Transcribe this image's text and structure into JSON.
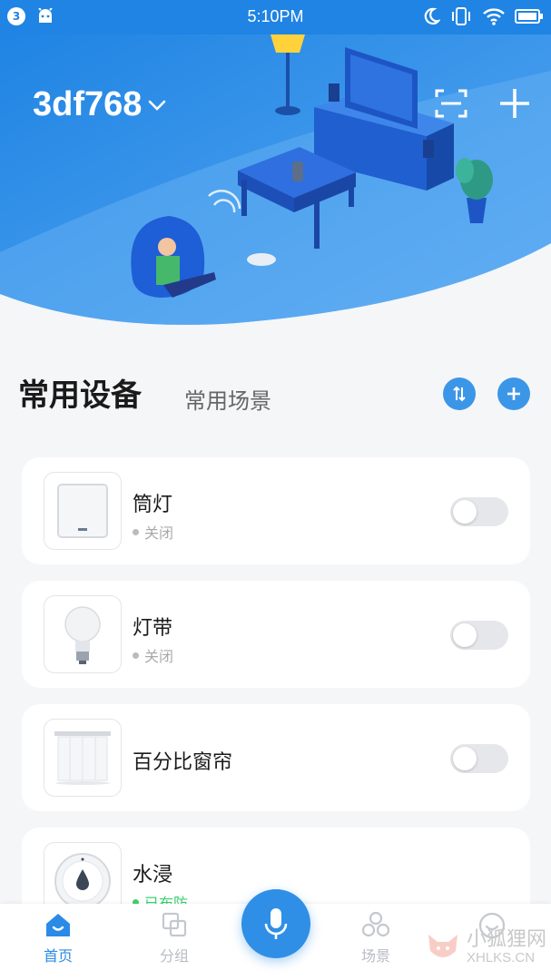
{
  "status_bar": {
    "notification_count": "3",
    "time": "5:10PM"
  },
  "header": {
    "home_name": "3df768"
  },
  "tabs": {
    "active": "常用设备",
    "inactive": "常用场景"
  },
  "devices": [
    {
      "name": "筒灯",
      "status": "关闭",
      "icon": "downlight-icon",
      "toggle_on": false
    },
    {
      "name": "灯带",
      "status": "关闭",
      "icon": "bulb-icon",
      "toggle_on": false
    },
    {
      "name": "百分比窗帘",
      "status": "",
      "icon": "curtain-icon",
      "toggle_on": false
    },
    {
      "name": "水浸",
      "status": "已布防",
      "icon": "water-sensor-icon",
      "status_color": "#3bd16f"
    }
  ],
  "bottom_nav": [
    {
      "label": "首页",
      "icon": "home-icon",
      "active": true
    },
    {
      "label": "分组",
      "icon": "group-icon",
      "active": false
    },
    {
      "label": "场景",
      "icon": "scene-icon",
      "active": false
    },
    {
      "label": "",
      "icon": "profile-icon",
      "active": false
    }
  ],
  "watermark": {
    "cn": "小狐狸网",
    "en": "XHLKS.CN"
  },
  "colors": {
    "primary": "#2f8fe6",
    "hero_blue": "#3b95ee",
    "active_green": "#3bd16f"
  }
}
